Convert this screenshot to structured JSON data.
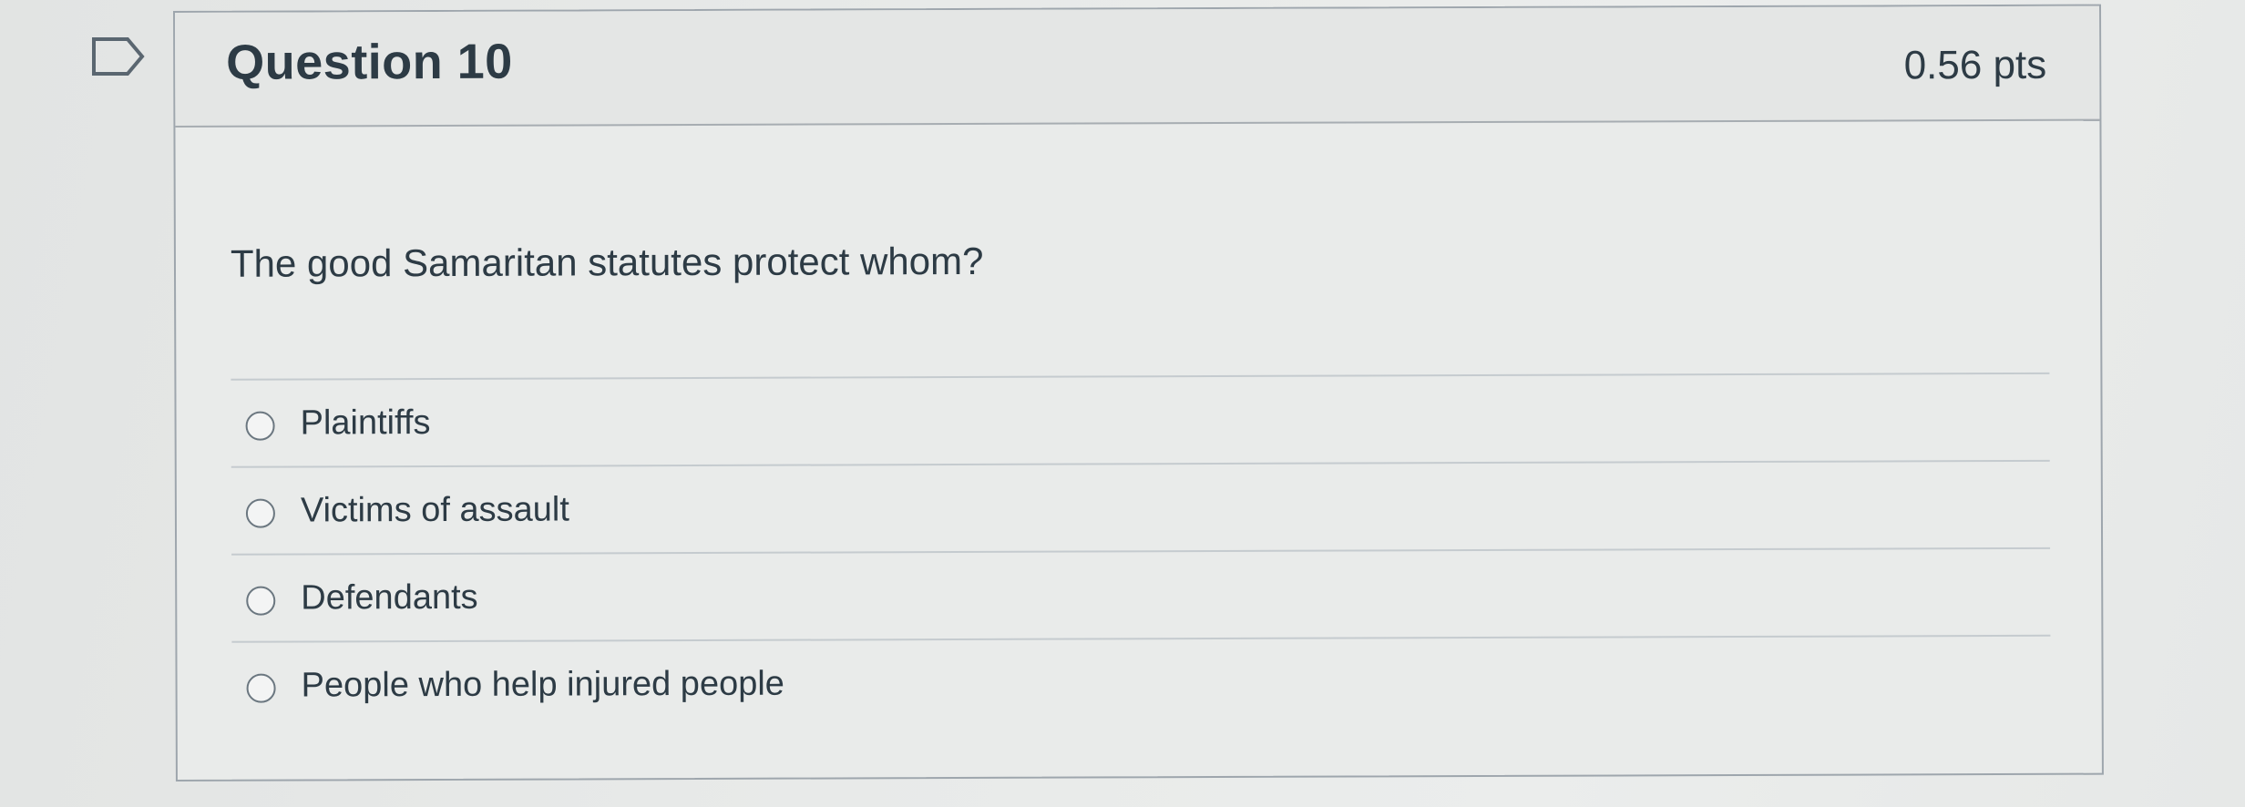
{
  "question": {
    "title": "Question 10",
    "points": "0.56 pts",
    "text": "The good Samaritan statutes protect whom?",
    "answers": [
      {
        "label": "Plaintiffs"
      },
      {
        "label": "Victims of assault"
      },
      {
        "label": "Defendants"
      },
      {
        "label": "People who help injured people"
      }
    ]
  },
  "icons": {
    "flag": "flag-bookmark-icon"
  },
  "colors": {
    "text": "#2d3b45",
    "border": "#9ea6ad",
    "background": "#e9ebea"
  }
}
